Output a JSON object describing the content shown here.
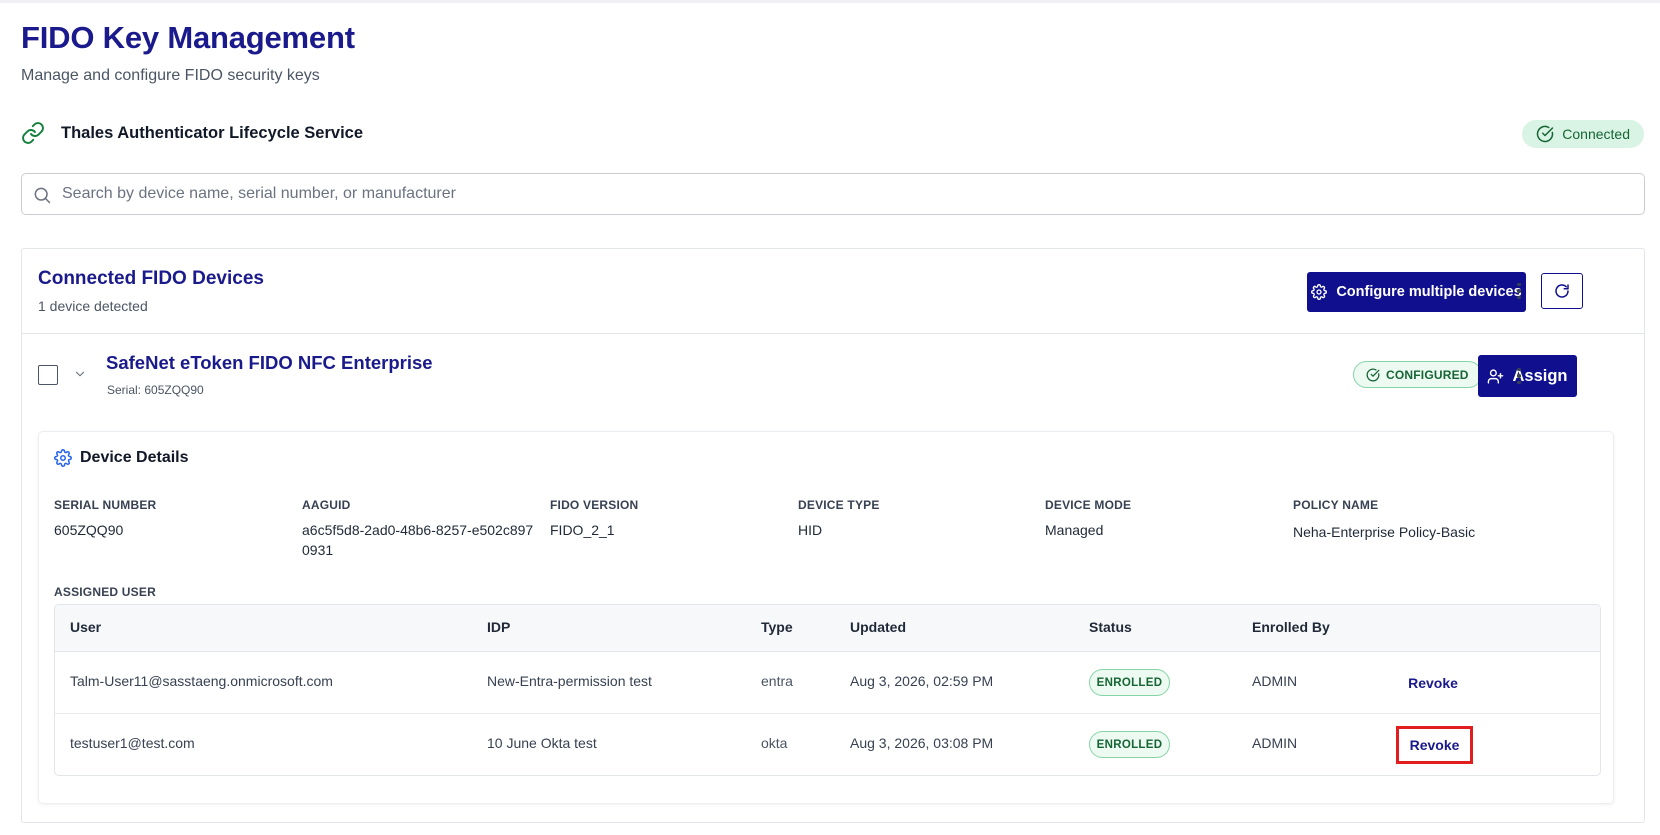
{
  "page": {
    "title": "FIDO Key Management",
    "subtitle": "Manage and configure FIDO security keys"
  },
  "service": {
    "name": "Thales Authenticator Lifecycle Service",
    "status": "Connected",
    "status_color": "#166534",
    "icon": "link-icon"
  },
  "search": {
    "placeholder": "Search by device name, serial number, or manufacturer",
    "value": ""
  },
  "devices_panel": {
    "title": "Connected FIDO Devices",
    "count_text": "1 device detected",
    "configure_label": "Configure multiple devices",
    "accent_color": "#10108f"
  },
  "device": {
    "name": "SafeNet eToken FIDO NFC Enterprise",
    "serial_line": "Serial: 605ZQQ90",
    "status_badge": "CONFIGURED",
    "assign_label": "Assign",
    "details_title": "Device Details",
    "fields": [
      {
        "label": "SERIAL NUMBER",
        "value": "605ZQQ90"
      },
      {
        "label": "AAGUID",
        "value": "a6c5f5d8-2ad0-48b6-8257-e502c8970931"
      },
      {
        "label": "FIDO VERSION",
        "value": "FIDO_2_1"
      },
      {
        "label": "DEVICE TYPE",
        "value": "HID"
      },
      {
        "label": "DEVICE MODE",
        "value": "Managed"
      },
      {
        "label": "POLICY NAME",
        "value": "Neha-Enterprise Policy-Basic"
      }
    ],
    "assigned_user_label": "ASSIGNED USER"
  },
  "users_table": {
    "columns": [
      "User",
      "IDP",
      "Type",
      "Updated",
      "Status",
      "Enrolled By"
    ],
    "rows": [
      {
        "user": "Talm-User11@sasstaeng.onmicrosoft.com",
        "idp": "New-Entra-permission test",
        "type": "entra",
        "updated": "Aug 3, 2026, 02:59 PM",
        "status": "ENROLLED",
        "enrolled_by": "ADMIN",
        "action": "Revoke"
      },
      {
        "user": "testuser1@test.com",
        "idp": "10 June Okta test",
        "type": "okta",
        "updated": "Aug 3, 2026, 03:08 PM",
        "status": "ENROLLED",
        "enrolled_by": "ADMIN",
        "action": "Revoke"
      }
    ],
    "highlight_color": "#e11d1d"
  }
}
